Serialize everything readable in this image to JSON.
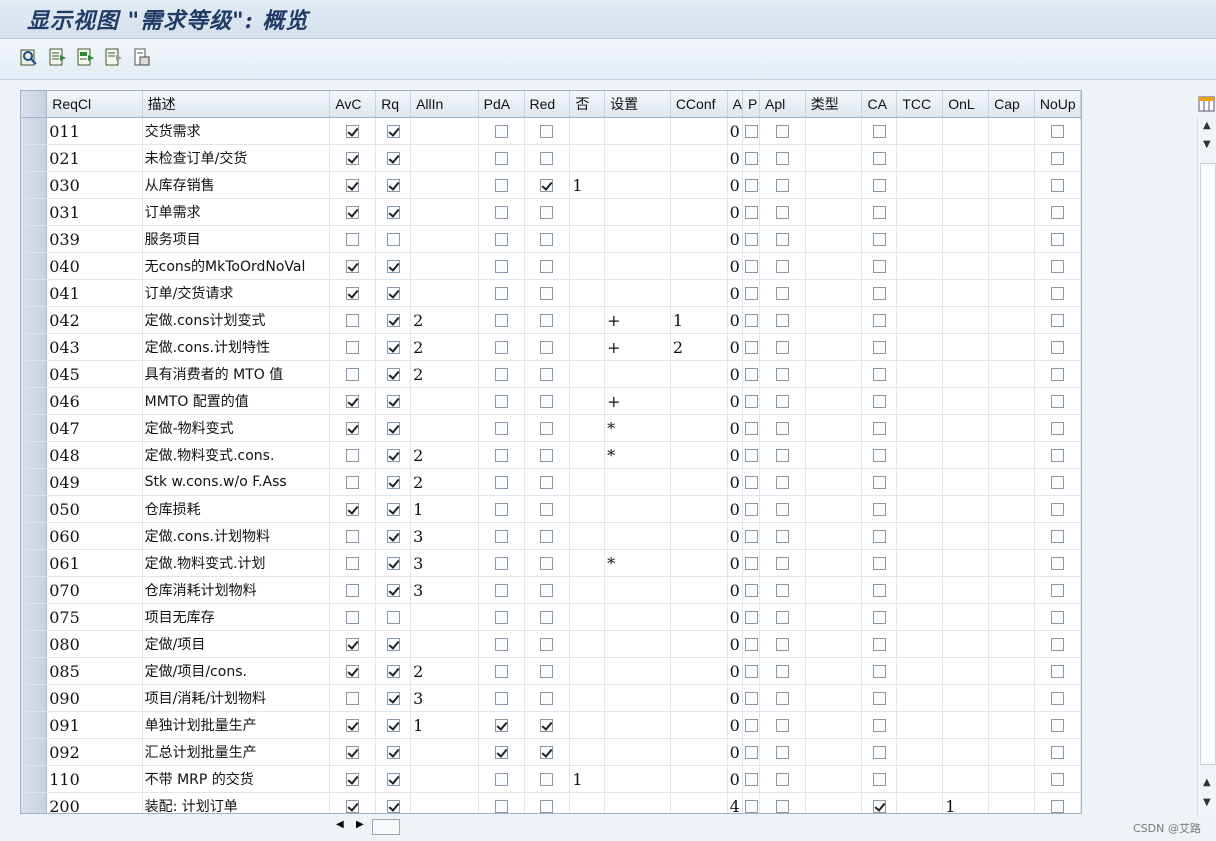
{
  "window": {
    "title": "显示视图 \"需求等级\": 概览"
  },
  "toolbar": {
    "buttons": [
      "details-icon",
      "select-all-icon",
      "select-block-icon",
      "deselect-all-icon",
      "print-icon"
    ]
  },
  "table": {
    "columns": [
      "",
      "ReqCl",
      "描述",
      "AvC",
      "Rq",
      "AllIn",
      "PdA",
      "Red",
      "否",
      "设置",
      "CConf",
      "A",
      "P",
      "Apl",
      "类型",
      "CA",
      "TCC",
      "OnL",
      "Cap",
      "NoUp"
    ],
    "rows": [
      {
        "reqcl": "011",
        "desc": "交货需求",
        "avc": true,
        "rq": true,
        "allin": "",
        "pda": false,
        "red": false,
        "no": "",
        "set": "",
        "cconf": "",
        "a": "0",
        "p": false,
        "apl": false,
        "type": "",
        "ca": false,
        "tcc": "",
        "onl": "",
        "cap": "",
        "noup": false
      },
      {
        "reqcl": "021",
        "desc": "未检查订单/交货",
        "avc": true,
        "rq": true,
        "allin": "",
        "pda": false,
        "red": false,
        "no": "",
        "set": "",
        "cconf": "",
        "a": "0",
        "p": false,
        "apl": false,
        "type": "",
        "ca": false,
        "tcc": "",
        "onl": "",
        "cap": "",
        "noup": false
      },
      {
        "reqcl": "030",
        "desc": "从库存销售",
        "avc": true,
        "rq": true,
        "allin": "",
        "pda": false,
        "red": true,
        "no": "1",
        "set": "",
        "cconf": "",
        "a": "0",
        "p": false,
        "apl": false,
        "type": "",
        "ca": false,
        "tcc": "",
        "onl": "",
        "cap": "",
        "noup": false
      },
      {
        "reqcl": "031",
        "desc": "订单需求",
        "avc": true,
        "rq": true,
        "allin": "",
        "pda": false,
        "red": false,
        "no": "",
        "set": "",
        "cconf": "",
        "a": "0",
        "p": false,
        "apl": false,
        "type": "",
        "ca": false,
        "tcc": "",
        "onl": "",
        "cap": "",
        "noup": false
      },
      {
        "reqcl": "039",
        "desc": "服务项目",
        "avc": false,
        "rq": false,
        "allin": "",
        "pda": false,
        "red": false,
        "no": "",
        "set": "",
        "cconf": "",
        "a": "0",
        "p": false,
        "apl": false,
        "type": "",
        "ca": false,
        "tcc": "",
        "onl": "",
        "cap": "",
        "noup": false
      },
      {
        "reqcl": "040",
        "desc": "无cons的MkToOrdNoVal",
        "avc": true,
        "rq": true,
        "allin": "",
        "pda": false,
        "red": false,
        "no": "",
        "set": "",
        "cconf": "",
        "a": "0",
        "p": false,
        "apl": false,
        "type": "",
        "ca": false,
        "tcc": "",
        "onl": "",
        "cap": "",
        "noup": false
      },
      {
        "reqcl": "041",
        "desc": "订单/交货请求",
        "avc": true,
        "rq": true,
        "allin": "",
        "pda": false,
        "red": false,
        "no": "",
        "set": "",
        "cconf": "",
        "a": "0",
        "p": false,
        "apl": false,
        "type": "",
        "ca": false,
        "tcc": "",
        "onl": "",
        "cap": "",
        "noup": false
      },
      {
        "reqcl": "042",
        "desc": "定做.cons计划变式",
        "avc": false,
        "rq": true,
        "allin": "2",
        "pda": false,
        "red": false,
        "no": "",
        "set": "+",
        "cconf": "1",
        "a": "0",
        "p": false,
        "apl": false,
        "type": "",
        "ca": false,
        "tcc": "",
        "onl": "",
        "cap": "",
        "noup": false
      },
      {
        "reqcl": "043",
        "desc": "定做.cons.计划特性",
        "avc": false,
        "rq": true,
        "allin": "2",
        "pda": false,
        "red": false,
        "no": "",
        "set": "+",
        "cconf": "2",
        "a": "0",
        "p": false,
        "apl": false,
        "type": "",
        "ca": false,
        "tcc": "",
        "onl": "",
        "cap": "",
        "noup": false
      },
      {
        "reqcl": "045",
        "desc": "具有消费者的 MTO 值",
        "avc": false,
        "rq": true,
        "allin": "2",
        "pda": false,
        "red": false,
        "no": "",
        "set": "",
        "cconf": "",
        "a": "0",
        "p": false,
        "apl": false,
        "type": "",
        "ca": false,
        "tcc": "",
        "onl": "",
        "cap": "",
        "noup": false
      },
      {
        "reqcl": "046",
        "desc": "MMTO 配置的值",
        "avc": true,
        "rq": true,
        "allin": "",
        "pda": false,
        "red": false,
        "no": "",
        "set": "+",
        "cconf": "",
        "a": "0",
        "p": false,
        "apl": false,
        "type": "",
        "ca": false,
        "tcc": "",
        "onl": "",
        "cap": "",
        "noup": false
      },
      {
        "reqcl": "047",
        "desc": "定做-物料变式",
        "avc": true,
        "rq": true,
        "allin": "",
        "pda": false,
        "red": false,
        "no": "",
        "set": "*",
        "cconf": "",
        "a": "0",
        "p": false,
        "apl": false,
        "type": "",
        "ca": false,
        "tcc": "",
        "onl": "",
        "cap": "",
        "noup": false
      },
      {
        "reqcl": "048",
        "desc": "定做.物料变式.cons.",
        "avc": false,
        "rq": true,
        "allin": "2",
        "pda": false,
        "red": false,
        "no": "",
        "set": "*",
        "cconf": "",
        "a": "0",
        "p": false,
        "apl": false,
        "type": "",
        "ca": false,
        "tcc": "",
        "onl": "",
        "cap": "",
        "noup": false
      },
      {
        "reqcl": "049",
        "desc": "Stk w.cons.w/o F.Ass",
        "avc": false,
        "rq": true,
        "allin": "2",
        "pda": false,
        "red": false,
        "no": "",
        "set": "",
        "cconf": "",
        "a": "0",
        "p": false,
        "apl": false,
        "type": "",
        "ca": false,
        "tcc": "",
        "onl": "",
        "cap": "",
        "noup": false
      },
      {
        "reqcl": "050",
        "desc": "仓库损耗",
        "avc": true,
        "rq": true,
        "allin": "1",
        "pda": false,
        "red": false,
        "no": "",
        "set": "",
        "cconf": "",
        "a": "0",
        "p": false,
        "apl": false,
        "type": "",
        "ca": false,
        "tcc": "",
        "onl": "",
        "cap": "",
        "noup": false
      },
      {
        "reqcl": "060",
        "desc": "定做.cons.计划物料",
        "avc": false,
        "rq": true,
        "allin": "3",
        "pda": false,
        "red": false,
        "no": "",
        "set": "",
        "cconf": "",
        "a": "0",
        "p": false,
        "apl": false,
        "type": "",
        "ca": false,
        "tcc": "",
        "onl": "",
        "cap": "",
        "noup": false
      },
      {
        "reqcl": "061",
        "desc": "定做.物料变式.计划",
        "avc": false,
        "rq": true,
        "allin": "3",
        "pda": false,
        "red": false,
        "no": "",
        "set": "*",
        "cconf": "",
        "a": "0",
        "p": false,
        "apl": false,
        "type": "",
        "ca": false,
        "tcc": "",
        "onl": "",
        "cap": "",
        "noup": false
      },
      {
        "reqcl": "070",
        "desc": "仓库消耗计划物料",
        "avc": false,
        "rq": true,
        "allin": "3",
        "pda": false,
        "red": false,
        "no": "",
        "set": "",
        "cconf": "",
        "a": "0",
        "p": false,
        "apl": false,
        "type": "",
        "ca": false,
        "tcc": "",
        "onl": "",
        "cap": "",
        "noup": false
      },
      {
        "reqcl": "075",
        "desc": "项目无库存",
        "avc": false,
        "rq": false,
        "allin": "",
        "pda": false,
        "red": false,
        "no": "",
        "set": "",
        "cconf": "",
        "a": "0",
        "p": false,
        "apl": false,
        "type": "",
        "ca": false,
        "tcc": "",
        "onl": "",
        "cap": "",
        "noup": false
      },
      {
        "reqcl": "080",
        "desc": "定做/项目",
        "avc": true,
        "rq": true,
        "allin": "",
        "pda": false,
        "red": false,
        "no": "",
        "set": "",
        "cconf": "",
        "a": "0",
        "p": false,
        "apl": false,
        "type": "",
        "ca": false,
        "tcc": "",
        "onl": "",
        "cap": "",
        "noup": false
      },
      {
        "reqcl": "085",
        "desc": "定做/项目/cons.",
        "avc": true,
        "rq": true,
        "allin": "2",
        "pda": false,
        "red": false,
        "no": "",
        "set": "",
        "cconf": "",
        "a": "0",
        "p": false,
        "apl": false,
        "type": "",
        "ca": false,
        "tcc": "",
        "onl": "",
        "cap": "",
        "noup": false
      },
      {
        "reqcl": "090",
        "desc": "项目/消耗/计划物料",
        "avc": false,
        "rq": true,
        "allin": "3",
        "pda": false,
        "red": false,
        "no": "",
        "set": "",
        "cconf": "",
        "a": "0",
        "p": false,
        "apl": false,
        "type": "",
        "ca": false,
        "tcc": "",
        "onl": "",
        "cap": "",
        "noup": false
      },
      {
        "reqcl": "091",
        "desc": "单独计划批量生产",
        "avc": true,
        "rq": true,
        "allin": "1",
        "pda": true,
        "red": true,
        "no": "",
        "set": "",
        "cconf": "",
        "a": "0",
        "p": false,
        "apl": false,
        "type": "",
        "ca": false,
        "tcc": "",
        "onl": "",
        "cap": "",
        "noup": false
      },
      {
        "reqcl": "092",
        "desc": "汇总计划批量生产",
        "avc": true,
        "rq": true,
        "allin": "",
        "pda": true,
        "red": true,
        "no": "",
        "set": "",
        "cconf": "",
        "a": "0",
        "p": false,
        "apl": false,
        "type": "",
        "ca": false,
        "tcc": "",
        "onl": "",
        "cap": "",
        "noup": false
      },
      {
        "reqcl": "110",
        "desc": "不带 MRP 的交货",
        "avc": true,
        "rq": true,
        "allin": "",
        "pda": false,
        "red": false,
        "no": "1",
        "set": "",
        "cconf": "",
        "a": "0",
        "p": false,
        "apl": false,
        "type": "",
        "ca": false,
        "tcc": "",
        "onl": "",
        "cap": "",
        "noup": false
      },
      {
        "reqcl": "200",
        "desc": "装配: 计划订单",
        "avc": true,
        "rq": true,
        "allin": "",
        "pda": false,
        "red": false,
        "no": "",
        "set": "",
        "cconf": "",
        "a": "4",
        "p": false,
        "apl": false,
        "type": "",
        "ca": true,
        "tcc": "",
        "onl": "1",
        "cap": "",
        "noup": false
      }
    ]
  },
  "watermark": "CSDN @艾路"
}
